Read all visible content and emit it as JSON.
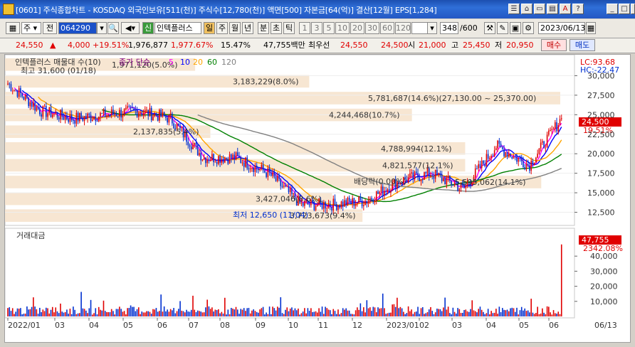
{
  "window": {
    "title": "[0601] 주식종합차트 - KOSDAQ 외국인보유[511(천)] 주식수[12,780(천)] 액면[500] 자본금[64(억)] 결산[12월] EPS[1,284]"
  },
  "toolbar": {
    "period_select": "주",
    "prev_label": "전",
    "code": "064290",
    "credit_badge": "신",
    "stock_name": "인텍플러스",
    "tab_day": "일",
    "tab_week": "주",
    "tab_month": "월",
    "tab_year": "년",
    "tab_min": "분",
    "tab_tick": "초",
    "tab_tick2": "틱",
    "intervals": [
      "1",
      "3",
      "5",
      "10",
      "20",
      "30",
      "60",
      "120"
    ],
    "count": "348",
    "count_total": "/600",
    "date": "2023/06/13"
  },
  "quote": {
    "price": "24,550",
    "change": "4,000",
    "change_pct": "+19.51%",
    "volume": "1,976,877",
    "volume_ratio": "1,977.67%",
    "turnover": "15.47%",
    "amount": "47,755백만",
    "best_ask_label": "최우선",
    "best_ask": "24,550",
    "best_bid": "24,500",
    "open_label": "시",
    "open": "21,000",
    "high_label": "고",
    "high": "25,450",
    "low_label": "저",
    "low": "20,950",
    "buy_label": "매수",
    "sell_label": "매도"
  },
  "price_panel": {
    "legend_name": "인텍플러스 매물대 수(10)",
    "ma_label": "종가 단순",
    "ma_periods": [
      "5",
      "10",
      "20",
      "60",
      "120"
    ],
    "ma_colors": [
      "#ff00ff",
      "#0000ff",
      "#ffa500",
      "#008000",
      "#808080"
    ],
    "high_note": "최고 31,600 (01/18)",
    "low_note": "최저 12,650 (11/04)",
    "div_note": "배당락(0.00%)",
    "lc": "LC:93.68",
    "hc": "HC:-22.47",
    "current_price": "24,500",
    "current_pct": "19.51%",
    "y_ticks": [
      "30,000",
      "27,500",
      "25,000",
      "22,500",
      "20,000",
      "17,500",
      "15,000",
      "12,500"
    ],
    "volume_profile": [
      {
        "label": "1,971,120(5.0%)"
      },
      {
        "label": "3,183,229(8.0%)"
      },
      {
        "label": "5,781,687(14.6%)(27,130.00 ~ 25,370.00)"
      },
      {
        "label": "4,244,468(10.7%)"
      },
      {
        "label": "2,137,835(5.4%)"
      },
      {
        "label": "4,788,994(12.1%)"
      },
      {
        "label": "4,821,577(12.1%)"
      },
      {
        "label": "5,595,062(14.1%)"
      },
      {
        "label": "3,427,046(8.6%)"
      },
      {
        "label": "3,723,673(9.4%)"
      }
    ]
  },
  "volume_panel": {
    "label": "거래대금",
    "current": "47,755",
    "current_pct": "2342.08%",
    "y_ticks": [
      "40,000",
      "30,000",
      "20,000",
      "10,000"
    ]
  },
  "x_axis": {
    "ticks": [
      "2022/01",
      "03",
      "04",
      "05",
      "06",
      "07",
      "08",
      "09",
      "10",
      "11",
      "12",
      "2023/01",
      "02",
      "03",
      "04",
      "05",
      "06"
    ],
    "last": "06/13"
  },
  "chart_data": {
    "type": "candlestick",
    "title": "인텍플러스 매물대 수(10)",
    "price_range": [
      11000,
      32500
    ],
    "volume_profile_values": [
      1971120,
      3183229,
      5781687,
      4244468,
      2137835,
      4788994,
      4821577,
      5595062,
      3427046,
      3723673
    ],
    "volume_profile_pct": [
      5.0,
      8.0,
      14.6,
      10.7,
      5.4,
      12.1,
      12.1,
      14.1,
      8.6,
      9.4
    ],
    "close_approx": [
      [
        "2022/01",
        29000
      ],
      [
        "2022/02",
        25500
      ],
      [
        "2022/03",
        24500
      ],
      [
        "2022/04",
        25000
      ],
      [
        "2022/05",
        25500
      ],
      [
        "2022/06",
        24500
      ],
      [
        "2022/07",
        19500
      ],
      [
        "2022/08",
        19500
      ],
      [
        "2022/09",
        17500
      ],
      [
        "2022/10",
        13500
      ],
      [
        "2022/11",
        13500
      ],
      [
        "2022/12",
        14000
      ],
      [
        "2023/01",
        16500
      ],
      [
        "2023/02",
        17500
      ],
      [
        "2023/03",
        15500
      ],
      [
        "2023/04",
        21000
      ],
      [
        "2023/05",
        18500
      ],
      [
        "2023/06",
        24550
      ]
    ],
    "high": {
      "value": 31600,
      "date": "01/18"
    },
    "low": {
      "value": 12650,
      "date": "11/04"
    },
    "last_volume_amount": 47755
  }
}
